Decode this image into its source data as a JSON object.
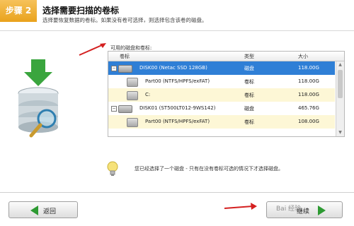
{
  "header": {
    "step_label": "步骤 2",
    "title": "选择需要扫描的卷标",
    "subtitle": "选择要恢复数据的卷标。如果没有卷可选择，则选择包含该卷的磁盘。"
  },
  "disk_list": {
    "label": "可用的磁盘和卷标:",
    "columns": {
      "name": "卷标",
      "type": "类型",
      "size": "大小"
    },
    "rows": [
      {
        "name": "DISK00 (Netac SSD 128GB)",
        "type": "磁盘",
        "size": "118.00G",
        "kind": "disk",
        "selected": true
      },
      {
        "name": "Part00 (NTFS/HPFS/exFAT)",
        "type": "卷标",
        "size": "118.00G",
        "kind": "volume",
        "selected": false
      },
      {
        "name": "C:",
        "type": "卷标",
        "size": "118.00G",
        "kind": "volume",
        "selected": false
      },
      {
        "name": "DISK01 (ST500LT012-9WS142)",
        "type": "磁盘",
        "size": "465.76G",
        "kind": "disk",
        "selected": false
      },
      {
        "name": "Part00 (NTFS/HPFS/exFAT)",
        "type": "卷标",
        "size": "108.00G",
        "kind": "volume",
        "selected": false
      }
    ]
  },
  "hint": {
    "text": "您已经选择了一个磁盘 - 只有在没有卷标可选的情况下才选择磁盘。"
  },
  "footer": {
    "back_label": "返回",
    "next_label": "继续"
  },
  "watermark": "Bai 经验",
  "colors": {
    "step_badge": "#e9a21c",
    "selected_row": "#2f7fd6",
    "alt_row": "#fdf7d6",
    "arrow": "#d42020",
    "button_arrow": "#2d9a32"
  }
}
